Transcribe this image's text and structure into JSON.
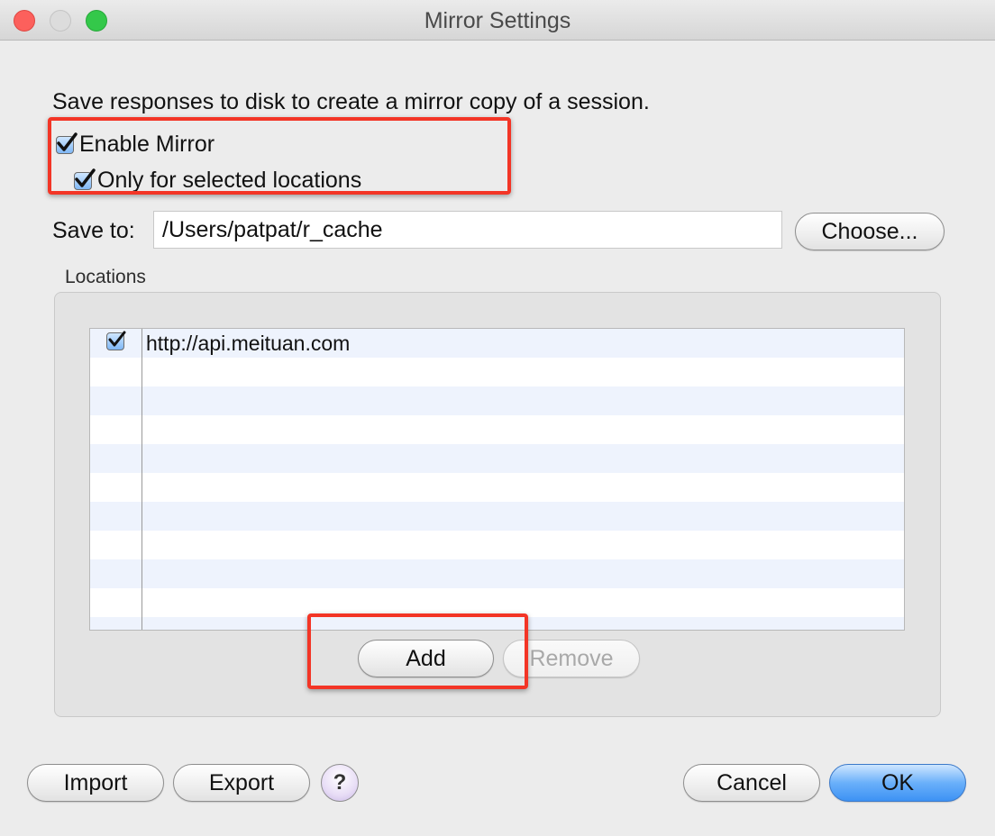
{
  "window": {
    "title": "Mirror Settings"
  },
  "description": "Save responses to disk to create a mirror copy of a session.",
  "options": {
    "enable_mirror": {
      "label": "Enable Mirror",
      "checked": true
    },
    "only_selected": {
      "label": "Only for selected locations",
      "checked": true
    }
  },
  "save_to": {
    "label": "Save to:",
    "value": "/Users/patpat/r_cache",
    "choose_label": "Choose..."
  },
  "locations": {
    "label": "Locations",
    "items": [
      {
        "enabled": true,
        "url": "http://api.meituan.com"
      }
    ],
    "add_label": "Add",
    "remove_label": "Remove"
  },
  "footer": {
    "import_label": "Import",
    "export_label": "Export",
    "help_label": "?",
    "cancel_label": "Cancel",
    "ok_label": "OK"
  },
  "colors": {
    "highlight": "#f33526",
    "accent": "#3d92f4"
  }
}
